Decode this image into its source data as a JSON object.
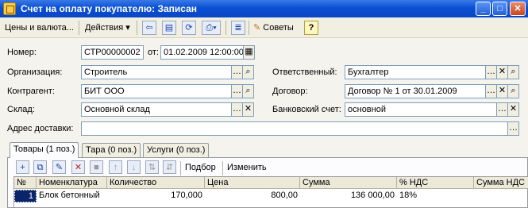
{
  "window": {
    "title": "Счет на оплату покупателю: Записан"
  },
  "toolbar": {
    "prices_menu": "Цены и валюта...",
    "actions_menu": "Действия",
    "tips_label": "Советы",
    "help_label": "?"
  },
  "form": {
    "number_label": "Номер:",
    "number_value": "СТР00000002",
    "date_label": "от:",
    "date_value": "01.02.2009 12:00:00",
    "org_label": "Организация:",
    "org_value": "Строитель",
    "responsible_label": "Ответственный:",
    "responsible_value": "Бухгалтер",
    "contractor_label": "Контрагент:",
    "contractor_value": "БИТ ООО",
    "contract_label": "Договор:",
    "contract_value": "Договор № 1 от 30.01.2009",
    "warehouse_label": "Склад:",
    "warehouse_value": "Основной склад",
    "bank_label": "Банковский счет:",
    "bank_value": "основной",
    "address_label": "Адрес доставки:",
    "address_value": ""
  },
  "tabs": [
    {
      "label": "Товары (1 поз.)"
    },
    {
      "label": "Тара (0 поз.)"
    },
    {
      "label": "Услуги (0 поз.)"
    }
  ],
  "table_toolbar": {
    "select_label": "Подбор",
    "change_label": "Изменить"
  },
  "table": {
    "columns": [
      "№",
      "Номенклатура",
      "Количество",
      "Цена",
      "Сумма",
      "% НДС",
      "Сумма НДС"
    ],
    "rows": [
      {
        "n": "1",
        "item": "Блок бетонный",
        "qty": "170,000",
        "price": "800,00",
        "sum": "136 000,00",
        "vat": "18%",
        "vat_sum": ""
      }
    ]
  }
}
